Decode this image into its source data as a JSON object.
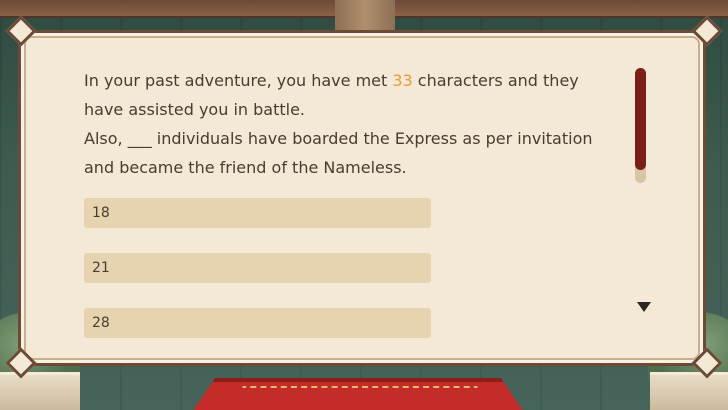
{
  "question": {
    "line1_before": "In your past adventure, you have met ",
    "line1_highlight": "33",
    "line1_after": " characters and they have assisted you in battle.",
    "line2": "Also, ___ individuals have boarded the Express as per invitation and became the friend of the Nameless."
  },
  "options": [
    {
      "label": "18"
    },
    {
      "label": "21"
    },
    {
      "label": "28"
    }
  ],
  "colors": {
    "highlight": "#e79a36",
    "panel": "#f4e9d7",
    "option": "#e6d3af",
    "scroll_thumb": "#7a1e19"
  }
}
